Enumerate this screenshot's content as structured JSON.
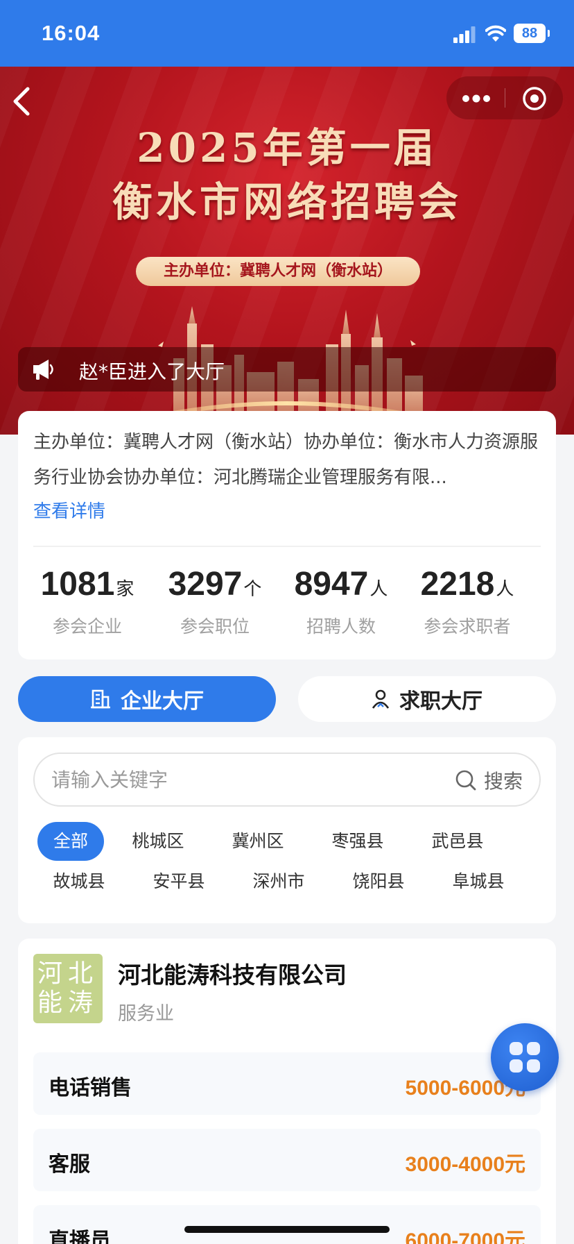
{
  "status_bar": {
    "time": "16:04",
    "battery": "88"
  },
  "banner": {
    "title_line1": "2025年第一届",
    "title_line2": "衡水市网络招聘会",
    "organizer": "主办单位：冀聘人才网（衡水站）",
    "ticker": "赵*臣进入了大厅"
  },
  "info": {
    "description": "主办单位：冀聘人才网（衡水站）协办单位：衡水市人力资源服务行业协会协办单位：河北腾瑞企业管理服务有限...",
    "view_detail": "查看详情",
    "stats": [
      {
        "value": "1081",
        "unit": "家",
        "label": "参会企业"
      },
      {
        "value": "3297",
        "unit": "个",
        "label": "参会职位"
      },
      {
        "value": "8947",
        "unit": "人",
        "label": "招聘人数"
      },
      {
        "value": "2218",
        "unit": "人",
        "label": "参会求职者"
      }
    ]
  },
  "tabs": {
    "company": "企业大厅",
    "jobseeker": "求职大厅"
  },
  "search": {
    "placeholder": "请输入关键字",
    "button": "搜索"
  },
  "districts": [
    "全部",
    "桃城区",
    "冀州区",
    "枣强县",
    "武邑县",
    "故城县",
    "安平县",
    "深州市",
    "饶阳县",
    "阜城县"
  ],
  "company": {
    "logo_text": "河北能涛",
    "name": "河北能涛科技有限公司",
    "industry": "服务业",
    "jobs": [
      {
        "title": "电话销售",
        "salary": "5000-6000元"
      },
      {
        "title": "客服",
        "salary": "3000-4000元"
      },
      {
        "title": "直播员",
        "salary": "6000-7000元"
      }
    ]
  },
  "colors": {
    "primary": "#2f7bea",
    "banner_red": "#b3141d",
    "salary_orange": "#e8801c"
  }
}
